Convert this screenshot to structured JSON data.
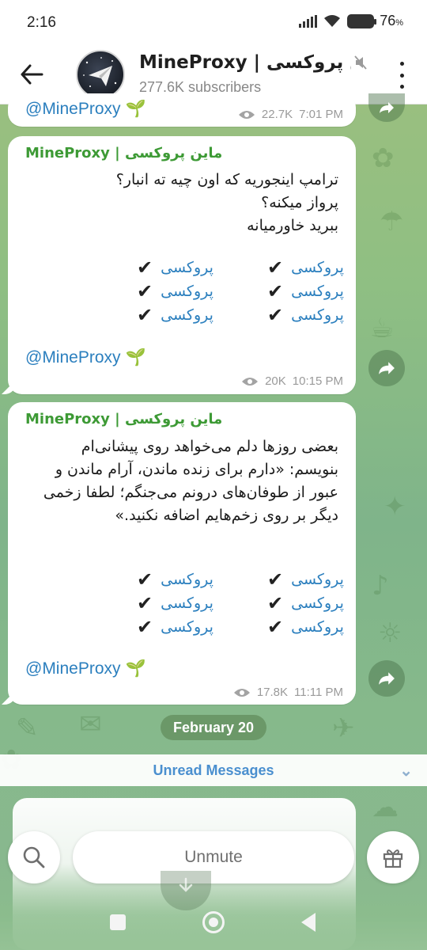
{
  "status_bar": {
    "time": "2:16",
    "battery": "76",
    "battery_suffix": "%"
  },
  "header": {
    "title": "MineProxy | ماین پروکسی",
    "subscribers": "277.6K subscribers"
  },
  "top_partial": {
    "handle": "@MineProxy",
    "views": "22.7K",
    "time": "7:01 PM"
  },
  "messages": [
    {
      "sender": "MineProxy | ماین پروکسی",
      "lines": [
        "ترامپ اینجوریه که اون چیه ته انبار؟",
        "پرواز میکنه؟",
        "ببرید خاورمیانه"
      ],
      "proxy_links": [
        "پروکسی",
        "پروکسی",
        "پروکسی",
        "پروکسی",
        "پروکسی",
        "پروکسی"
      ],
      "check_mark": "✔",
      "handle": "@MineProxy",
      "views": "20K",
      "time": "10:15 PM"
    },
    {
      "sender": "MineProxy | ماین پروکسی",
      "lines": [
        "بعضی روزها دلم می‌خواهد روی پیشانی‌ام",
        "بنویسم: «دارم برای زنده ماندن، آرام ماندن و",
        "عبور از طوفان‌های درونم می‌جنگم؛ لطفا زخمی",
        "دیگر بر روی زخم‌هایم اضافه نکنید.»"
      ],
      "proxy_links": [
        "پروکسی",
        "پروکسی",
        "پروکسی",
        "پروکسی",
        "پروکسی",
        "پروکسی"
      ],
      "check_mark": "✔",
      "handle": "@MineProxy",
      "views": "17.8K",
      "time": "11:11 PM"
    }
  ],
  "date_separator": "February 20",
  "unread_label": "Unread Messages",
  "bottom_bar": {
    "unmute_label": "Unmute"
  },
  "icons": {
    "back": "arrow-left-icon",
    "more": "more-vertical-icon",
    "mute": "muted-speaker-icon",
    "views": "eye-icon",
    "share": "forward-arrow-icon",
    "search": "search-icon",
    "gift": "gift-icon",
    "handle_emoji": "seedling-icon"
  },
  "colors": {
    "accent_green": "#3d9a35",
    "link_blue": "#2b7fbe",
    "unread_blue": "#4a8fcf"
  }
}
